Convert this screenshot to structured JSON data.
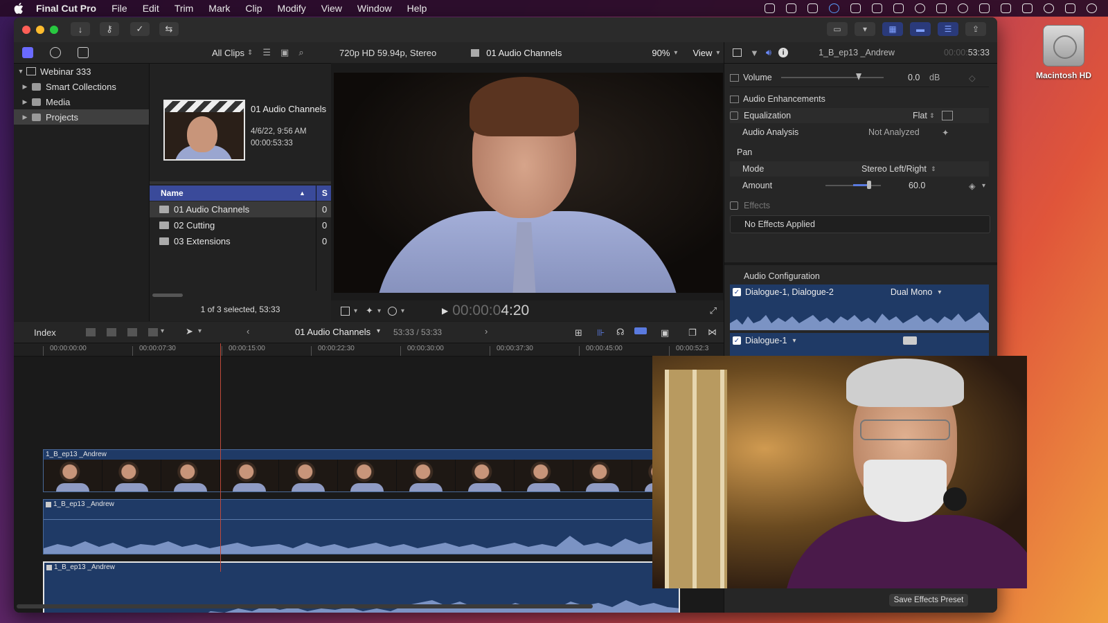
{
  "menubar": {
    "app_name": "Final Cut Pro",
    "items": [
      "File",
      "Edit",
      "Trim",
      "Mark",
      "Clip",
      "Modify",
      "View",
      "Window",
      "Help"
    ]
  },
  "desktop": {
    "drive_label": "Macintosh HD"
  },
  "sidebar": {
    "library": "Webinar 333",
    "items": [
      "Smart Collections",
      "Media",
      "Projects"
    ]
  },
  "browser": {
    "filter": "All Clips",
    "selected_clip": {
      "title": "01 Audio Channels",
      "date": "4/6/22, 9:56 AM",
      "duration": "00:00:53:33"
    },
    "column_name": "Name",
    "column_s": "S",
    "rows": [
      {
        "name": "01 Audio Channels",
        "s": "0"
      },
      {
        "name": "02 Cutting",
        "s": "0"
      },
      {
        "name": "03 Extensions",
        "s": "0"
      }
    ],
    "status": "1 of 3 selected, 53:33"
  },
  "viewer": {
    "format": "720p HD 59.94p, Stereo",
    "project": "01 Audio Channels",
    "zoom": "90%",
    "view": "View",
    "timecode_dim": "00:00:0",
    "timecode": "4:20"
  },
  "inspector": {
    "clip_name": "1_B_ep13 _Andrew",
    "clip_time_dim": "00:00:",
    "clip_time": "53:33",
    "volume_label": "Volume",
    "volume_value": "0.0",
    "volume_unit": "dB",
    "audio_enh": "Audio Enhancements",
    "eq_label": "Equalization",
    "eq_value": "Flat",
    "analysis_label": "Audio Analysis",
    "analysis_value": "Not Analyzed",
    "pan_label": "Pan",
    "mode_label": "Mode",
    "mode_value": "Stereo Left/Right",
    "amount_label": "Amount",
    "amount_value": "60.0",
    "effects_label": "Effects",
    "no_effects": "No Effects Applied",
    "audio_config": "Audio Configuration",
    "config1": "Dialogue-1, Dialogue-2",
    "config1_mode": "Dual Mono",
    "config2": "Dialogue-1",
    "save_preset": "Save Effects Preset"
  },
  "timeline": {
    "index": "Index",
    "project": "01 Audio Channels",
    "duration": "53:33 / 53:33",
    "ticks": [
      "00:00:00:00",
      "00:00:07:30",
      "00:00:15:00",
      "00:00:22:30",
      "00:00:30:00",
      "00:00:37:30",
      "00:00:45:00",
      "00:00:52:3"
    ],
    "video_clip": "1_B_ep13 _Andrew",
    "audio_clip1": "1_B_ep13 _Andrew",
    "audio_clip2": "1_B_ep13 _Andrew"
  },
  "colors": {
    "accent": "#3a4a9a",
    "playhead": "#c04a3a",
    "audio_clip": "#1f3a66"
  }
}
